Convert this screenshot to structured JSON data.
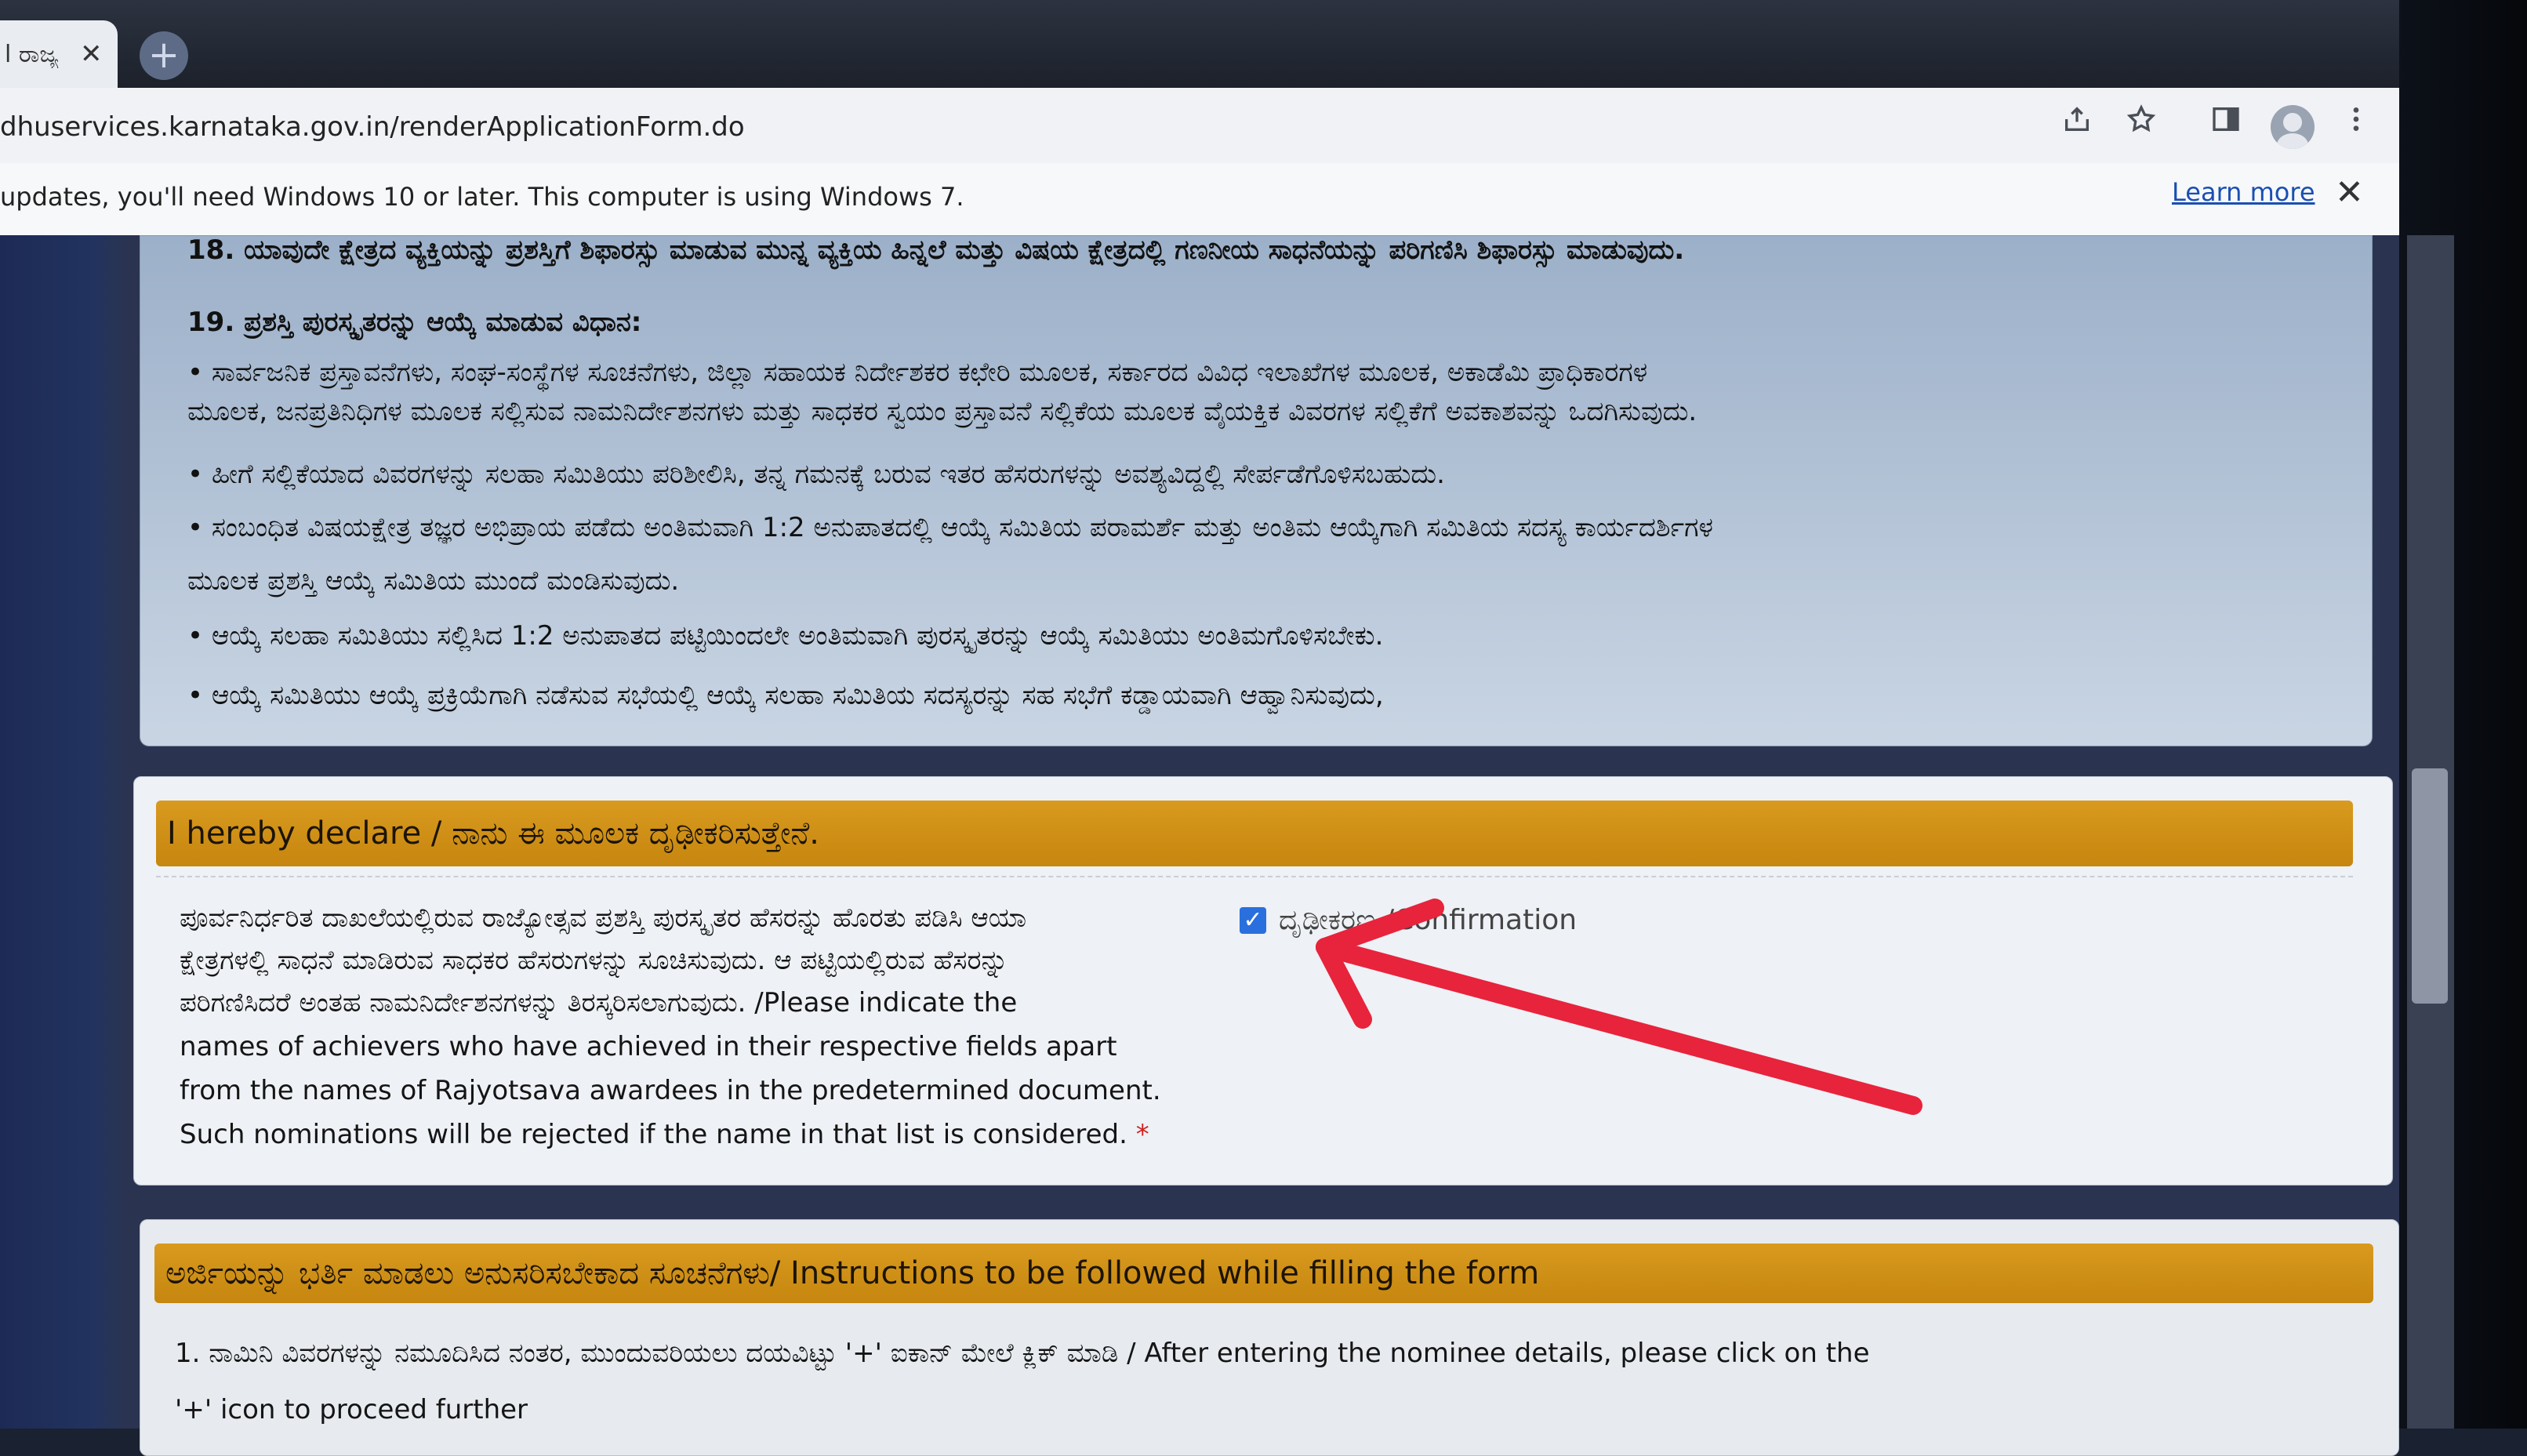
{
  "browser": {
    "tab_title": "l ರಾಜ್ಯ",
    "tab_close": "✕",
    "new_tab": "+",
    "url": "dhuservices.karnataka.gov.in/renderApplicationForm.do",
    "infobar_text": "updates, you'll need Windows 10 or later. This computer is using Windows 7.",
    "learn_more": "Learn more",
    "infobar_close": "✕"
  },
  "section19": {
    "line18": "18. ಯಾವುದೇ ಕ್ಷೇತ್ರದ ವ್ಯಕ್ತಿಯನ್ನು ಪ್ರಶಸ್ತಿಗೆ ಶಿಫಾರಸ್ಸು ಮಾಡುವ ಮುನ್ನ ವ್ಯಕ್ತಿಯ ಹಿನ್ನಲೆ ಮತ್ತು ವಿಷಯ ಕ್ಷೇತ್ರದಲ್ಲಿ ಗಣನೀಯ ಸಾಧನೆಯನ್ನು ಪರಿಗಣಿಸಿ ಶಿಫಾರಸ್ಸು ಮಾಡುವುದು.",
    "heading": "19. ಪ್ರಶಸ್ತಿ ಪುರಸ್ಕೃತರನ್ನು ಆಯ್ಕೆ ಮಾಡುವ ವಿಧಾನ:",
    "bullet1_a": "• ಸಾರ್ವಜನಿಕ ಪ್ರಸ್ತಾವನೆಗಳು, ಸಂಘ-ಸಂಸ್ಥೆಗಳ ಸೂಚನೆಗಳು, ಜಿಲ್ಲಾ ಸಹಾಯಕ ನಿರ್ದೇಶಕರ ಕಛೇರಿ ಮೂಲಕ, ಸರ್ಕಾರದ ವಿವಿಧ ಇಲಾಖೆಗಳ ಮೂಲಕ, ಅಕಾಡೆಮಿ ಪ್ರಾಧಿಕಾರಗಳ",
    "bullet1_b": "ಮೂಲಕ, ಜನಪ್ರತಿನಿಧಿಗಳ ಮೂಲಕ ಸಲ್ಲಿಸುವ ನಾಮನಿರ್ದೇಶನಗಳು ಮತ್ತು ಸಾಧಕರ ಸ್ವಯಂ ಪ್ರಸ್ತಾವನೆ ಸಲ್ಲಿಕೆಯ ಮೂಲಕ ವೈಯಕ್ತಿಕ ವಿವರಗಳ ಸಲ್ಲಿಕೆಗೆ ಅವಕಾಶವನ್ನು ಒದಗಿಸುವುದು.",
    "bullet2": "• ಹೀಗೆ ಸಲ್ಲಿಕೆಯಾದ ವಿವರಗಳನ್ನು ಸಲಹಾ ಸಮಿತಿಯು ಪರಿಶೀಲಿಸಿ, ತನ್ನ ಗಮನಕ್ಕೆ ಬರುವ ಇತರ ಹೆಸರುಗಳನ್ನು ಅವಶ್ಯವಿದ್ದಲ್ಲಿ ಸೇರ್ಪಡೆಗೊಳಿಸಬಹುದು.",
    "bullet3_a": "• ಸಂಬಂಧಿತ ವಿಷಯಕ್ಷೇತ್ರ ತಜ್ಞರ ಅಭಿಪ್ರಾಯ ಪಡೆದು ಅಂತಿಮವಾಗಿ 1:2 ಅನುಪಾತದಲ್ಲಿ ಆಯ್ಕೆ ಸಮಿತಿಯ ಪರಾಮರ್ಶೆ ಮತ್ತು ಅಂತಿಮ ಆಯ್ಕೆಗಾಗಿ ಸಮಿತಿಯ ಸದಸ್ಯ ಕಾರ್ಯದರ್ಶಿಗಳ",
    "bullet3_b": "ಮೂಲಕ ಪ್ರಶಸ್ತಿ ಆಯ್ಕೆ ಸಮಿತಿಯ ಮುಂದೆ ಮಂಡಿಸುವುದು.",
    "bullet4": "• ಆಯ್ಕೆ ಸಲಹಾ ಸಮಿತಿಯು ಸಲ್ಲಿಸಿದ 1:2 ಅನುಪಾತದ ಪಟ್ಟಿಯಿಂದಲೇ ಅಂತಿಮವಾಗಿ ಪುರಸ್ಕೃತರನ್ನು ಆಯ್ಕೆ ಸಮಿತಿಯು ಅಂತಿಮಗೊಳಿಸಬೇಕು.",
    "bullet5": "• ಆಯ್ಕೆ ಸಮಿತಿಯು ಆಯ್ಕೆ ಪ್ರಕ್ರಿಯೆಗಾಗಿ ನಡೆಸುವ ಸಭೆಯಲ್ಲಿ ಆಯ್ಕೆ ಸಲಹಾ ಸಮಿತಿಯ ಸದಸ್ಯರನ್ನು ಸಹ ಸಭೆಗೆ ಕಡ್ಡಾಯವಾಗಿ ಆಹ್ವಾನಿಸುವುದು,"
  },
  "declaration": {
    "title": "I hereby declare / ನಾನು ಈ ಮೂಲಕ ದೃಢೀಕರಿಸುತ್ತೇನೆ.",
    "line1": "ಪೂರ್ವನಿರ್ಧರಿತ ದಾಖಲೆಯಲ್ಲಿರುವ ರಾಜ್ಯೋತ್ಸವ ಪ್ರಶಸ್ತಿ ಪುರಸ್ಕೃತರ ಹೆಸರನ್ನು ಹೊರತು ಪಡಿಸಿ ಆಯಾ",
    "line2": "ಕ್ಷೇತ್ರಗಳಲ್ಲಿ ಸಾಧನೆ ಮಾಡಿರುವ ಸಾಧಕರ ಹೆಸರುಗಳನ್ನು ಸೂಚಿಸುವುದು. ಆ ಪಟ್ಟಿಯಲ್ಲಿರುವ ಹೆಸರನ್ನು",
    "line3": "ಪರಿಗಣಿಸಿದರೆ ಅಂತಹ ನಾಮನಿರ್ದೇಶನಗಳನ್ನು ತಿರಸ್ಕರಿಸಲಾಗುವುದು. /Please indicate the",
    "line4": "names of achievers who have achieved in their respective fields apart",
    "line5": "from the names of Rajyotsava awardees in the predetermined document.",
    "line6": "Such nominations will be rejected if the name in that list is considered.",
    "required_mark": "*",
    "checkbox_checked": true,
    "checkbox_glyph": "✓",
    "confirmation_label": "ದೃಢೀಕರಣ /Confirmation"
  },
  "instructions": {
    "title": "ಅರ್ಜಿಯನ್ನು ಭರ್ತಿ ಮಾಡಲು ಅನುಸರಿಸಬೇಕಾದ ಸೂಚನೆಗಳು/ Instructions to be followed while filling the form",
    "item1_a": "1. ನಾಮಿನಿ ವಿವರಗಳನ್ನು ನಮೂದಿಸಿದ ನಂತರ, ಮುಂದುವರಿಯಲು ದಯವಿಟ್ಟು '+' ಐಕಾನ್ ಮೇಲೆ ಕ್ಲಿಕ್ ಮಾಡಿ / After entering the nominee details, please click on the",
    "item1_b": "'+' icon to proceed further"
  },
  "colors": {
    "band": "#d99a1f",
    "checkbox": "#2a6fde",
    "arrow": "#e8233c",
    "link": "#1a4fb3"
  },
  "icons": [
    "share-icon",
    "star-icon",
    "sidepanel-icon",
    "profile-icon",
    "menu-icon",
    "close-icon",
    "checkmark-icon",
    "red-arrow-annotation"
  ]
}
